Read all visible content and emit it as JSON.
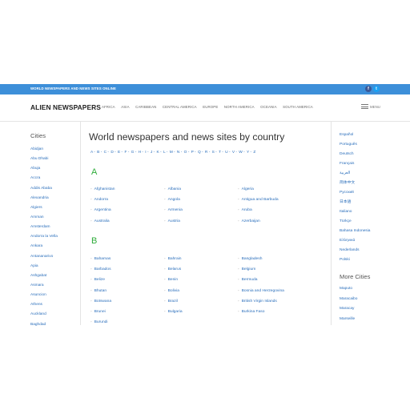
{
  "topbar": {
    "tagline": "WORLD NEWSPAPERS AND NEWS SITES ONLINE",
    "facebook_glyph": "f",
    "twitter_glyph": "t",
    "color": "#3d8fd9"
  },
  "header": {
    "logo": "ALIEN NEWSPAPERS",
    "nav": [
      "AFRICA",
      "ASIA",
      "CARIBBEAN",
      "CENTRAL AMERICA",
      "EUROPE",
      "NORTH AMERICA",
      "OCEANIA",
      "SOUTH AMERICA"
    ],
    "menu_label": "MENU"
  },
  "cities": {
    "heading": "Cities",
    "items": [
      "Abidjan",
      "Abu Dhabi",
      "Abuja",
      "Accra",
      "Addis Ababa",
      "Alexandria",
      "Algiers",
      "Amman",
      "Amsterdam",
      "Andorra la Vella",
      "Ankara",
      "Antananarivo",
      "Apia",
      "Ashgabat",
      "Asmara",
      "Asuncion",
      "Athens",
      "Auckland",
      "Baghdad"
    ]
  },
  "main": {
    "title": "World newspapers and news sites by country",
    "alphabet": [
      "A",
      "B",
      "C",
      "D",
      "E",
      "F",
      "G",
      "H",
      "I",
      "J",
      "K",
      "L",
      "M",
      "N",
      "O",
      "P",
      "Q",
      "R",
      "S",
      "T",
      "U",
      "V",
      "W",
      "Y",
      "Z"
    ],
    "sections": [
      {
        "letter": "A",
        "countries": [
          "Afghanistan",
          "Albania",
          "Algeria",
          "Andorra",
          "Angola",
          "Antigua and Barbuda",
          "Argentina",
          "Armenia",
          "Aruba",
          "Australia",
          "Austria",
          "Azerbaijan"
        ]
      },
      {
        "letter": "B",
        "countries": [
          "Bahamas",
          "Bahrain",
          "Bangladesh",
          "Barbados",
          "Belarus",
          "Belgium",
          "Belize",
          "Benin",
          "Bermuda",
          "Bhutan",
          "Bolivia",
          "Bosnia and Herzegovina",
          "Botswana",
          "Brazil",
          "British Virgin Islands",
          "Brunei",
          "Bulgaria",
          "Burkina Faso",
          "Burundi"
        ]
      }
    ],
    "letter_color": "#2eac3a"
  },
  "languages": [
    "Español",
    "Português",
    "Deutsch",
    "Français",
    "العربية",
    "简体中文",
    "Русский",
    "日本語",
    "Italiano",
    "Türkçe",
    "Bahasa Indonesia",
    "Ελληνικά",
    "Nederlands",
    "Polski"
  ],
  "more_cities": {
    "heading": "More Cities",
    "items": [
      "Maputo",
      "Maracaibo",
      "Maracay",
      "Marseille"
    ]
  },
  "link_color": "#2a6ebb"
}
